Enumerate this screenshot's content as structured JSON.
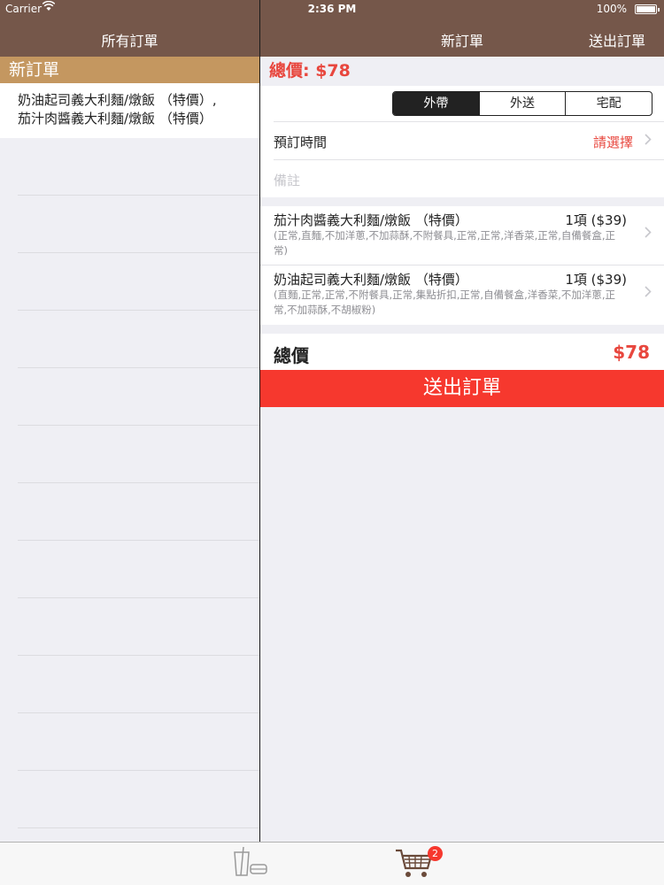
{
  "status": {
    "carrier": "Carrier",
    "time": "2:36 PM",
    "battery": "100%"
  },
  "nav": {
    "left_title": "所有訂單",
    "right_title": "新訂單",
    "right_action": "送出訂單"
  },
  "left": {
    "section_header": "新訂單",
    "orders": [
      {
        "line1": "奶油起司義大利麵/燉飯 （特價）,",
        "line2": "茄汁肉醬義大利麵/燉飯 （特價）"
      }
    ]
  },
  "right": {
    "total_top": "總價: $78",
    "segments": [
      "外帶",
      "外送",
      "宅配"
    ],
    "selected_segment": "外帶",
    "reserve_label": "預訂時間",
    "reserve_value": "請選擇",
    "note_placeholder": "備註",
    "items": [
      {
        "name": "茄汁肉醬義大利麵/燉飯 （特價）",
        "qty": "1項 ($39)",
        "desc": "(正常,直麵,不加洋蔥,不加蒜酥,不附餐具,正常,正常,洋香菜,正常,自備餐盒,正常)"
      },
      {
        "name": "奶油起司義大利麵/燉飯 （特價）",
        "qty": "1項 ($39)",
        "desc": "(直麵,正常,正常,不附餐具,正常,集點折扣,正常,自備餐盒,洋香菜,不加洋蔥,正常,不加蒜酥,不胡椒粉)"
      }
    ],
    "total_label": "總價",
    "total_value": "$78",
    "submit_label": "送出訂單"
  },
  "tabbar": {
    "cart_badge": "2",
    "tabs": [
      "drinks-icon",
      "cart-icon"
    ]
  },
  "colors": {
    "nav": "#75574a",
    "section": "#c49760",
    "accent": "#e8473e",
    "submit": "#f6382e"
  }
}
